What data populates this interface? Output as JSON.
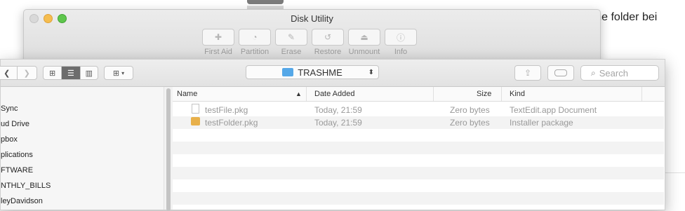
{
  "background": {
    "partial_text": "to the folder bei"
  },
  "disk_utility": {
    "title": "Disk Utility",
    "tools": [
      {
        "label": "First Aid",
        "icon": "stethoscope-icon"
      },
      {
        "label": "Partition",
        "icon": "pie-icon"
      },
      {
        "label": "Erase",
        "icon": "erase-icon"
      },
      {
        "label": "Restore",
        "icon": "restore-icon"
      },
      {
        "label": "Unmount",
        "icon": "eject-icon"
      },
      {
        "label": "Info",
        "icon": "info-icon"
      }
    ]
  },
  "finder": {
    "path_label": "TRASHME",
    "search_placeholder": "Search",
    "sidebar": [
      " Sync",
      "ud Drive",
      "pbox",
      "plications",
      "FTWARE",
      "NTHLY_BILLS",
      "leyDavidson"
    ],
    "columns": {
      "name": "Name",
      "date": "Date Added",
      "size": "Size",
      "kind": "Kind"
    },
    "files": [
      {
        "name": "testFile.pkg",
        "date": "Today, 21:59",
        "size": "Zero bytes",
        "kind": "TextEdit.app Document",
        "icon": "document-icon"
      },
      {
        "name": "testFolder.pkg",
        "date": "Today, 21:59",
        "size": "Zero bytes",
        "kind": "Installer package",
        "icon": "package-icon"
      }
    ]
  },
  "colors": {
    "folder": "#55a8e8",
    "active_view": "#6d6d6d"
  }
}
